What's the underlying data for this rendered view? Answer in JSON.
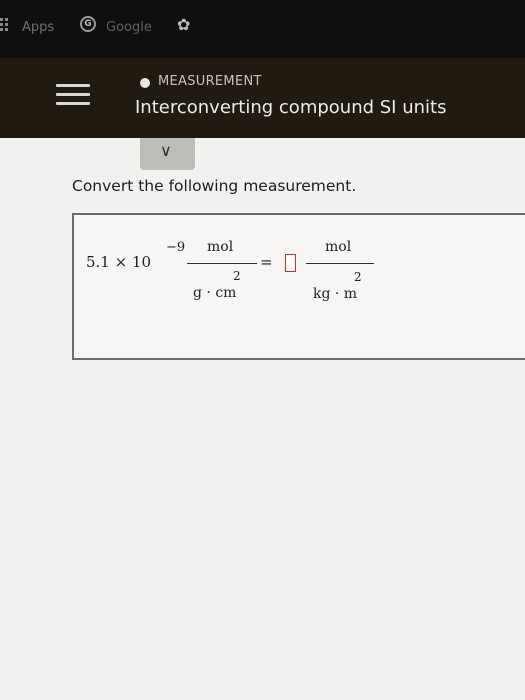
{
  "bookmarks": {
    "apps_label": "Apps",
    "google_label": "Google"
  },
  "header": {
    "category": "MEASUREMENT",
    "title": "Interconverting compound SI units"
  },
  "question": {
    "instruction": "Convert the following measurement.",
    "coefficient": "5.1 × 10",
    "exponent": "−9",
    "given_numerator": "mol",
    "given_denominator": "g · cm",
    "given_denominator_exponent": "2",
    "equals": "=",
    "answer_value": "",
    "target_numerator": "mol",
    "target_denominator": "kg · m",
    "target_denominator_exponent": "2"
  },
  "colors": {
    "header_bg": "#201a10",
    "answer_border": "#c4302b"
  }
}
